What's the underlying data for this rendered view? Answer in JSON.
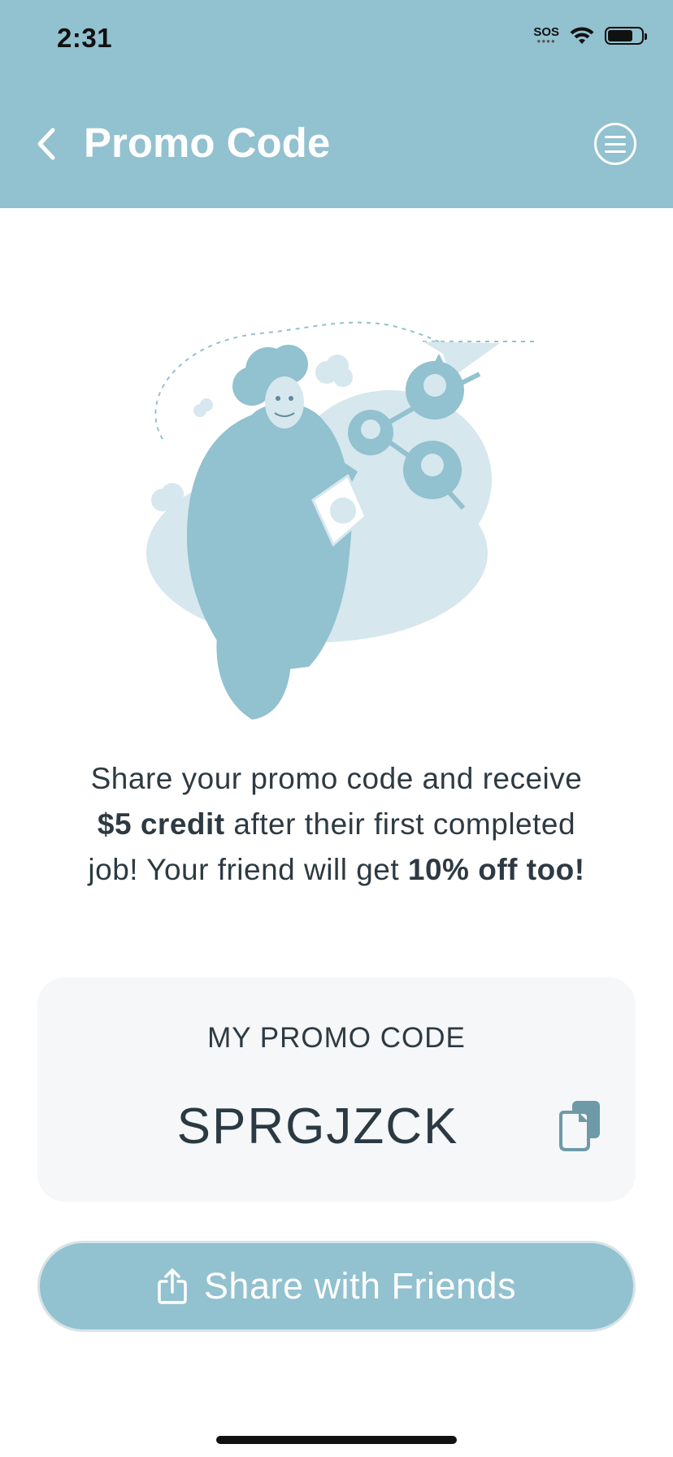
{
  "status_bar": {
    "time": "2:31",
    "sos": "SOS",
    "icons": [
      "wifi-icon",
      "battery-icon"
    ]
  },
  "header": {
    "title": "Promo Code",
    "back_icon": "chevron-left-icon",
    "menu_icon": "menu-icon"
  },
  "illustration": {
    "icon": "referral-illustration"
  },
  "description": {
    "part1": "Share your promo code and receive ",
    "bold1": "$5 credit",
    "part2": " after their first completed job! Your friend will get ",
    "bold2": "10% off too!"
  },
  "promo": {
    "label": "MY PROMO CODE",
    "code": "SPRGJZCK",
    "copy_icon": "copy-icon"
  },
  "share": {
    "label": "Share with Friends",
    "icon": "share-icon"
  },
  "colors": {
    "brand": "#92c1cf",
    "brand_light": "#d6e7ee",
    "text": "#2e3a42",
    "card_bg": "#f5f7f9"
  }
}
